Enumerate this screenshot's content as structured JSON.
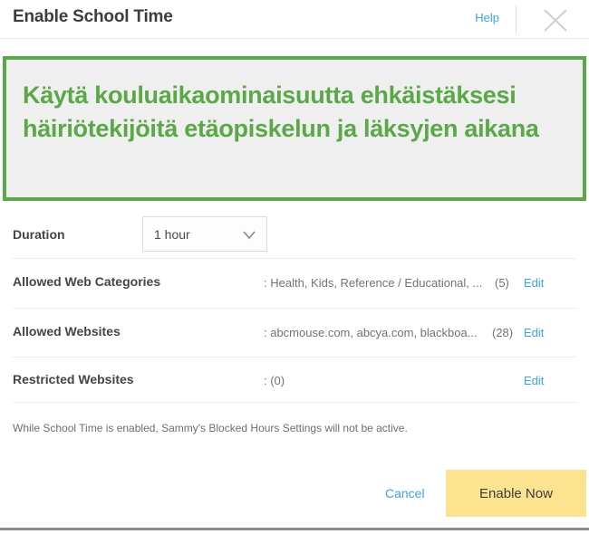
{
  "header": {
    "title": "Enable School Time",
    "help_label": "Help",
    "close_icon": "close-icon"
  },
  "notice": {
    "text": "Käytä kouluaikaominaisuutta ehkäistäksesi häiriötekijöitä etäopiskelun ja läksyjen aikana",
    "border_color": "#5aa847",
    "text_color": "#5aa847",
    "background_color": "#efefef"
  },
  "duration": {
    "label": "Duration",
    "selected_value": "1 hour",
    "caret_icon": "chevron-down-icon"
  },
  "settings": [
    {
      "label": "Allowed Web Categories",
      "value": ": Health, Kids, Reference / Educational, ...",
      "count": "(5)",
      "edit_label": "Edit"
    },
    {
      "label": "Allowed Websites",
      "value": ": abcmouse.com, abcya.com, blackboa...",
      "count": "(28)",
      "edit_label": "Edit"
    },
    {
      "label": "Restricted Websites",
      "value": ": (0)",
      "count": "",
      "edit_label": "Edit"
    }
  ],
  "footer": {
    "note": "While School Time is enabled, Sammy's Blocked Hours Settings will not be active.",
    "cancel_label": "Cancel",
    "enable_label": "Enable Now",
    "enable_color": "#fce390",
    "link_color": "#3ea2e0"
  }
}
